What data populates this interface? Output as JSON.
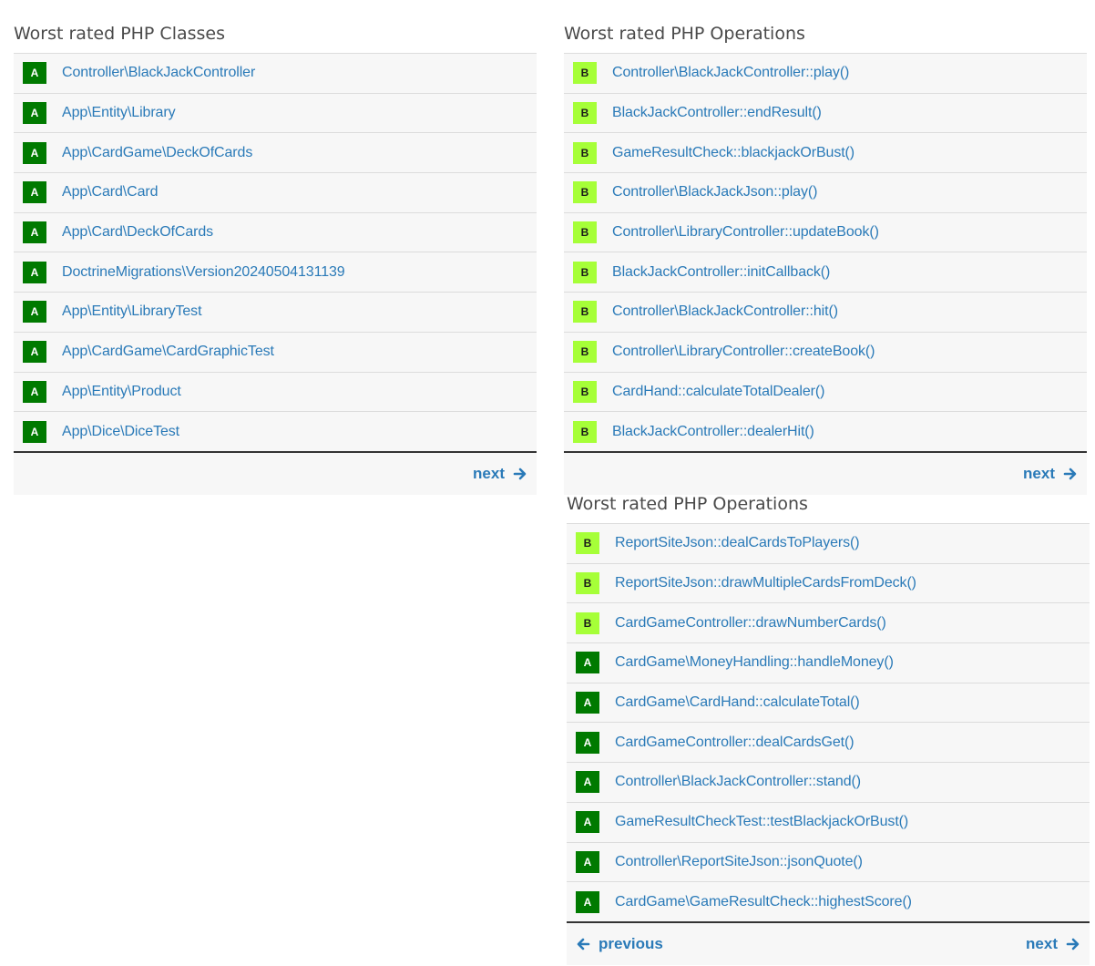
{
  "colors": {
    "grade_A": "#007a00",
    "grade_B": "#a6ff38",
    "link": "#2a7ab8"
  },
  "panels": [
    {
      "title": "Worst rated PHP Classes",
      "rows": [
        {
          "grade": "A",
          "name": "Controller\\BlackJackController"
        },
        {
          "grade": "A",
          "name": "App\\Entity\\Library"
        },
        {
          "grade": "A",
          "name": "App\\CardGame\\DeckOfCards"
        },
        {
          "grade": "A",
          "name": "App\\Card\\Card"
        },
        {
          "grade": "A",
          "name": "App\\Card\\DeckOfCards"
        },
        {
          "grade": "A",
          "name": "DoctrineMigrations\\Version20240504131139"
        },
        {
          "grade": "A",
          "name": "App\\Entity\\LibraryTest"
        },
        {
          "grade": "A",
          "name": "App\\CardGame\\CardGraphicTest"
        },
        {
          "grade": "A",
          "name": "App\\Entity\\Product"
        },
        {
          "grade": "A",
          "name": "App\\Dice\\DiceTest"
        }
      ],
      "previous_label": "",
      "next_label": "next"
    },
    {
      "title": "Worst rated PHP Operations",
      "rows": [
        {
          "grade": "B",
          "name": "Controller\\BlackJackController::play()"
        },
        {
          "grade": "B",
          "name": "BlackJackController::endResult()"
        },
        {
          "grade": "B",
          "name": "GameResultCheck::blackjackOrBust()"
        },
        {
          "grade": "B",
          "name": "Controller\\BlackJackJson::play()"
        },
        {
          "grade": "B",
          "name": "Controller\\LibraryController::updateBook()"
        },
        {
          "grade": "B",
          "name": "BlackJackController::initCallback()"
        },
        {
          "grade": "B",
          "name": "Controller\\BlackJackController::hit()"
        },
        {
          "grade": "B",
          "name": "Controller\\LibraryController::createBook()"
        },
        {
          "grade": "B",
          "name": "CardHand::calculateTotalDealer()"
        },
        {
          "grade": "B",
          "name": "BlackJackController::dealerHit()"
        }
      ],
      "previous_label": "",
      "next_label": "next"
    },
    {
      "title": "Worst rated PHP Operations",
      "rows": [
        {
          "grade": "B",
          "name": "ReportSiteJson::dealCardsToPlayers()"
        },
        {
          "grade": "B",
          "name": "ReportSiteJson::drawMultipleCardsFromDeck()"
        },
        {
          "grade": "B",
          "name": "CardGameController::drawNumberCards()"
        },
        {
          "grade": "A",
          "name": "CardGame\\MoneyHandling::handleMoney()"
        },
        {
          "grade": "A",
          "name": "CardGame\\CardHand::calculateTotal()"
        },
        {
          "grade": "A",
          "name": "CardGameController::dealCardsGet()"
        },
        {
          "grade": "A",
          "name": "Controller\\BlackJackController::stand()"
        },
        {
          "grade": "A",
          "name": "GameResultCheckTest::testBlackjackOrBust()"
        },
        {
          "grade": "A",
          "name": "Controller\\ReportSiteJson::jsonQuote()"
        },
        {
          "grade": "A",
          "name": "CardGame\\GameResultCheck::highestScore()"
        }
      ],
      "previous_label": "previous",
      "next_label": "next"
    }
  ]
}
